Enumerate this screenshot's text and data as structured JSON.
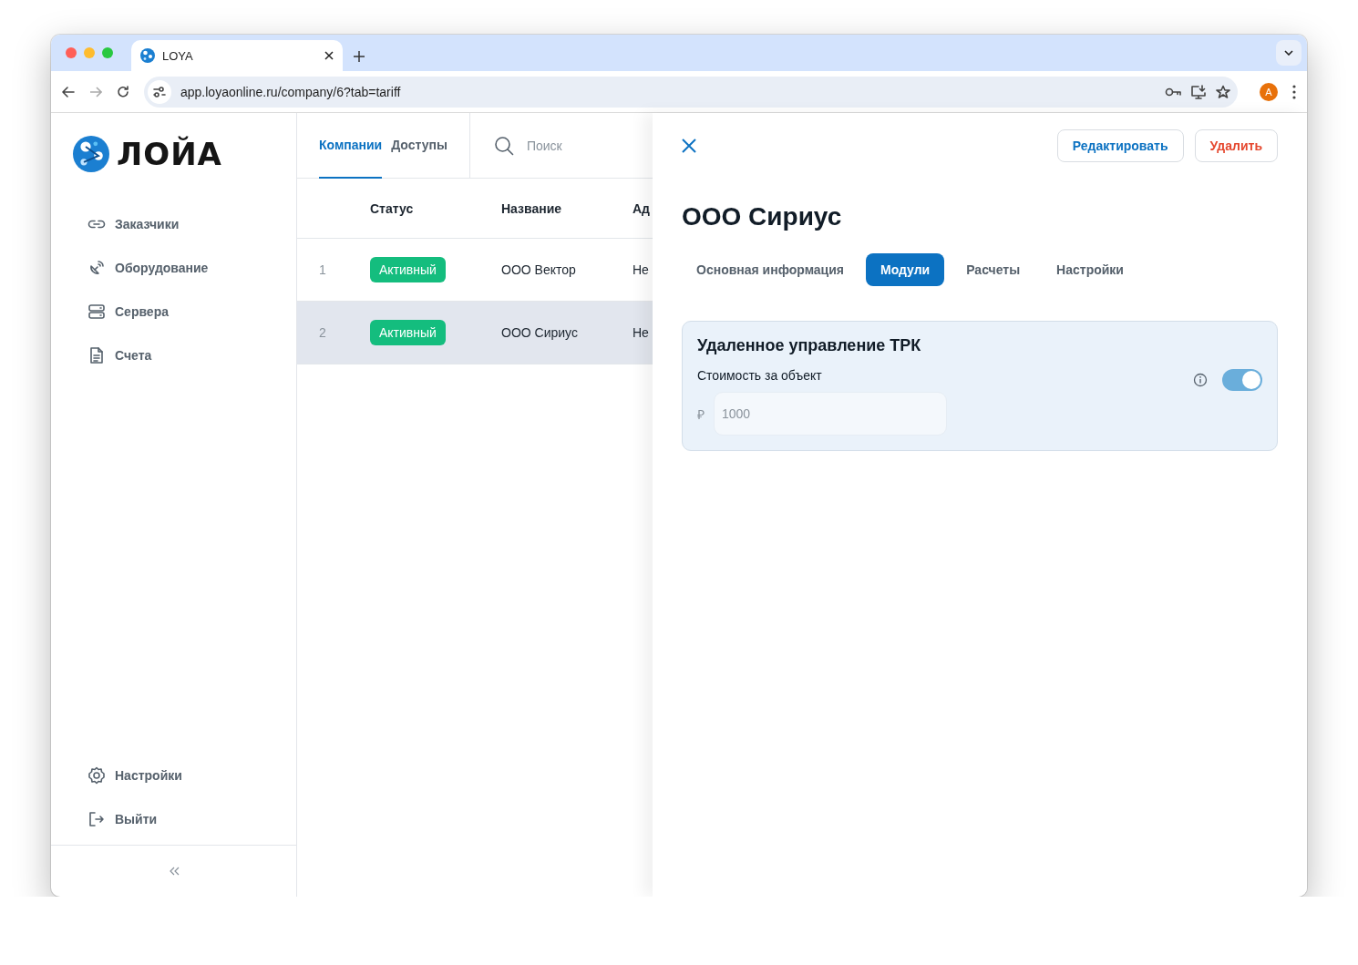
{
  "browser": {
    "tab_title": "LOYA",
    "url": "app.loyaonline.ru/company/6?tab=tariff",
    "avatar": "A"
  },
  "sidebar": {
    "logo": "ЛОЙА",
    "items": [
      {
        "label": "Заказчики"
      },
      {
        "label": "Оборудование"
      },
      {
        "label": "Сервера"
      },
      {
        "label": "Счета"
      }
    ],
    "bottom_items": [
      {
        "label": "Настройки"
      },
      {
        "label": "Выйти"
      }
    ]
  },
  "list": {
    "tabs": [
      {
        "label": "Компании",
        "selected": true
      },
      {
        "label": "Доступы",
        "selected": false
      }
    ],
    "search": {
      "placeholder": "Поиск"
    },
    "columns": [
      "Статус",
      "Название",
      "Ад"
    ],
    "rows": [
      {
        "index": "1",
        "status": "Активный",
        "name": "ООО Вектор",
        "column_3": "Не",
        "selected": false
      },
      {
        "index": "2",
        "status": "Активный",
        "name": "ООО Сириус",
        "column_3": "Не",
        "selected": true
      }
    ]
  },
  "detail": {
    "title": "ООО Сириус",
    "buttons": [
      {
        "label": "Редактировать",
        "kind": "primary"
      },
      {
        "label": "Удалить",
        "kind": "danger"
      }
    ],
    "tabs": [
      {
        "label": "Основная информация",
        "selected": false
      },
      {
        "label": "Модули",
        "selected": true
      },
      {
        "label": "Расчеты",
        "selected": false
      },
      {
        "label": "Настройки",
        "selected": false
      }
    ],
    "modules": [
      {
        "title": "Удаленное управление ТРК",
        "label": "Стоимость за объект",
        "currency": "₽",
        "placeholder": "1000",
        "on": true
      }
    ]
  }
}
